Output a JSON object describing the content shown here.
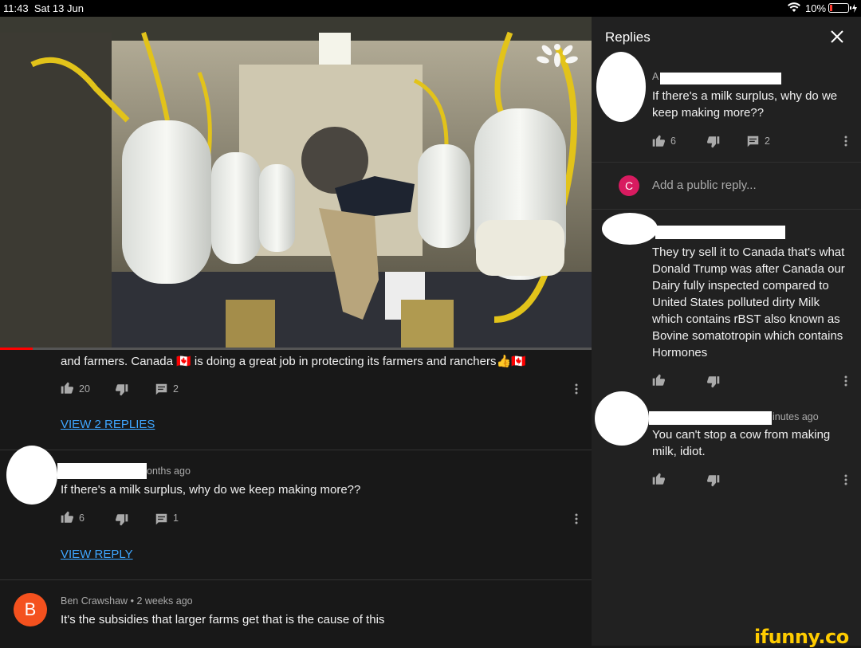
{
  "status_bar": {
    "time": "11:43",
    "date": "Sat 13 Jun",
    "battery": "10%"
  },
  "video": {
    "progress": 0.055
  },
  "comments": [
    {
      "text": "and farmers. Canada 🇨🇦 is doing a great job in protecting its farmers and ranchers👍🇨🇦",
      "likes": "20",
      "replies": "2",
      "view_replies": "VIEW 2 REPLIES"
    },
    {
      "meta_suffix": "onths ago",
      "text": "If there's a milk surplus, why do we keep making more??",
      "likes": "6",
      "replies": "1",
      "view_replies": "VIEW REPLY"
    },
    {
      "avatar_letter": "B",
      "avatar_color": "#f4511e",
      "author": "Ben Crawshaw",
      "separator": "•",
      "time": "2 weeks ago",
      "text": "It's the subsidies that larger farms get that is the cause of this"
    }
  ],
  "replies_panel": {
    "title": "Replies",
    "parent": {
      "author_partial": "A",
      "text": "If there's a milk surplus, why do we keep making more??",
      "likes": "6",
      "replies": "2"
    },
    "add_reply": {
      "avatar_letter": "C",
      "avatar_color": "#d81b60",
      "placeholder": "Add a public reply..."
    },
    "replies": [
      {
        "text": "They try sell it to Canada that's what Donald Trump was after Canada our Dairy fully inspected compared to United States polluted dirty Milk which contains rBST also known as Bovine somatotropin which contains Hormones"
      },
      {
        "meta_suffix": "inutes ago",
        "text": "You can't stop a cow from making milk, idiot."
      }
    ]
  },
  "watermark": "ifunny.co",
  "colors": {
    "link": "#3ea6ff",
    "progress": "#ff0000",
    "panel_bg": "#212121",
    "page_bg": "#181818"
  }
}
